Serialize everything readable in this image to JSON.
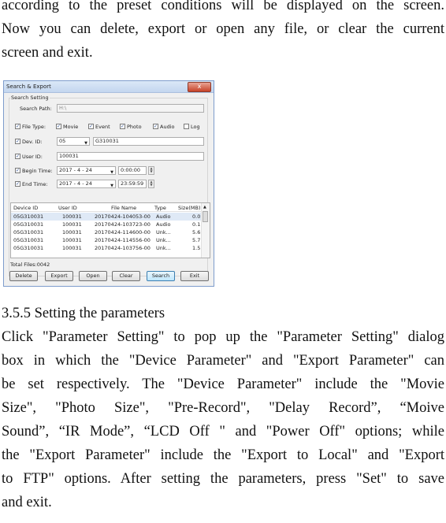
{
  "para1": {
    "lines": [
      "according to the preset conditions will be displayed on the screen.",
      "Now you can delete, export or open any file, or clear the current",
      "screen and exit."
    ]
  },
  "dialog": {
    "title": "Search & Export",
    "close_glyph": "x",
    "group_title": "Search Setting",
    "search_path_label": "Search Path:",
    "search_path_value": "H:\\",
    "file_type_label": "File Type:",
    "file_types": [
      {
        "label": "Movie",
        "checked": true
      },
      {
        "label": "Event",
        "checked": true
      },
      {
        "label": "Photo",
        "checked": true
      },
      {
        "label": "Audio",
        "checked": true
      },
      {
        "label": "Log",
        "checked": false
      }
    ],
    "dev_id_label": "Dev. ID:",
    "dev_id_select": "05",
    "dev_id_value": "G310031",
    "user_id_label": "User ID:",
    "user_id_value": "100031",
    "begin_time_label": "Begin Time:",
    "begin_date": "2017 - 4 - 24",
    "begin_time": "0:00:00",
    "end_time_label": "End Time:",
    "end_date": "2017 - 4 - 24",
    "end_time": "23:59:59",
    "columns": [
      "Device ID",
      "User ID",
      "File Name",
      "Type",
      "Size(MB)"
    ],
    "rows": [
      [
        "05G310031",
        "100031",
        "20170424-104053-00",
        "Audio",
        "0.0"
      ],
      [
        "05G310031",
        "100031",
        "20170424-103723-00",
        "Audio",
        "0.1"
      ],
      [
        "05G310031",
        "100031",
        "20170424-114600-00",
        "Unk...",
        "5.6"
      ],
      [
        "05G310031",
        "100031",
        "20170424-114556-00",
        "Unk...",
        "5.7"
      ],
      [
        "05G310031",
        "100031",
        "20170424-103756-00",
        "Unk...",
        "1.5"
      ]
    ],
    "total_files": "Total Files:0042",
    "buttons": [
      "Delete",
      "Export",
      "Open",
      "Clear",
      "Search",
      "Exit"
    ]
  },
  "heading": "3.5.5 Setting the parameters",
  "para2": {
    "lines": [
      "Click \"Parameter Setting\" to pop up the \"Parameter Setting\" dialog",
      "box in which the \"Device Parameter\" and \"Export Parameter\" can",
      "be set respectively. The \"Device Parameter\" include the \"Movie",
      "Size\", \"Photo Size\", \"Pre-Record\", \"Delay Record”, “Moive",
      "Sound”, “IR Mode”, “LCD Off \" and \"Power Off\" options; while",
      "the \"Export Parameter\" include the \"Export to Local\" and \"Export",
      "to FTP\" options. After setting the parameters, press \"Set\" to save",
      "and exit."
    ]
  }
}
